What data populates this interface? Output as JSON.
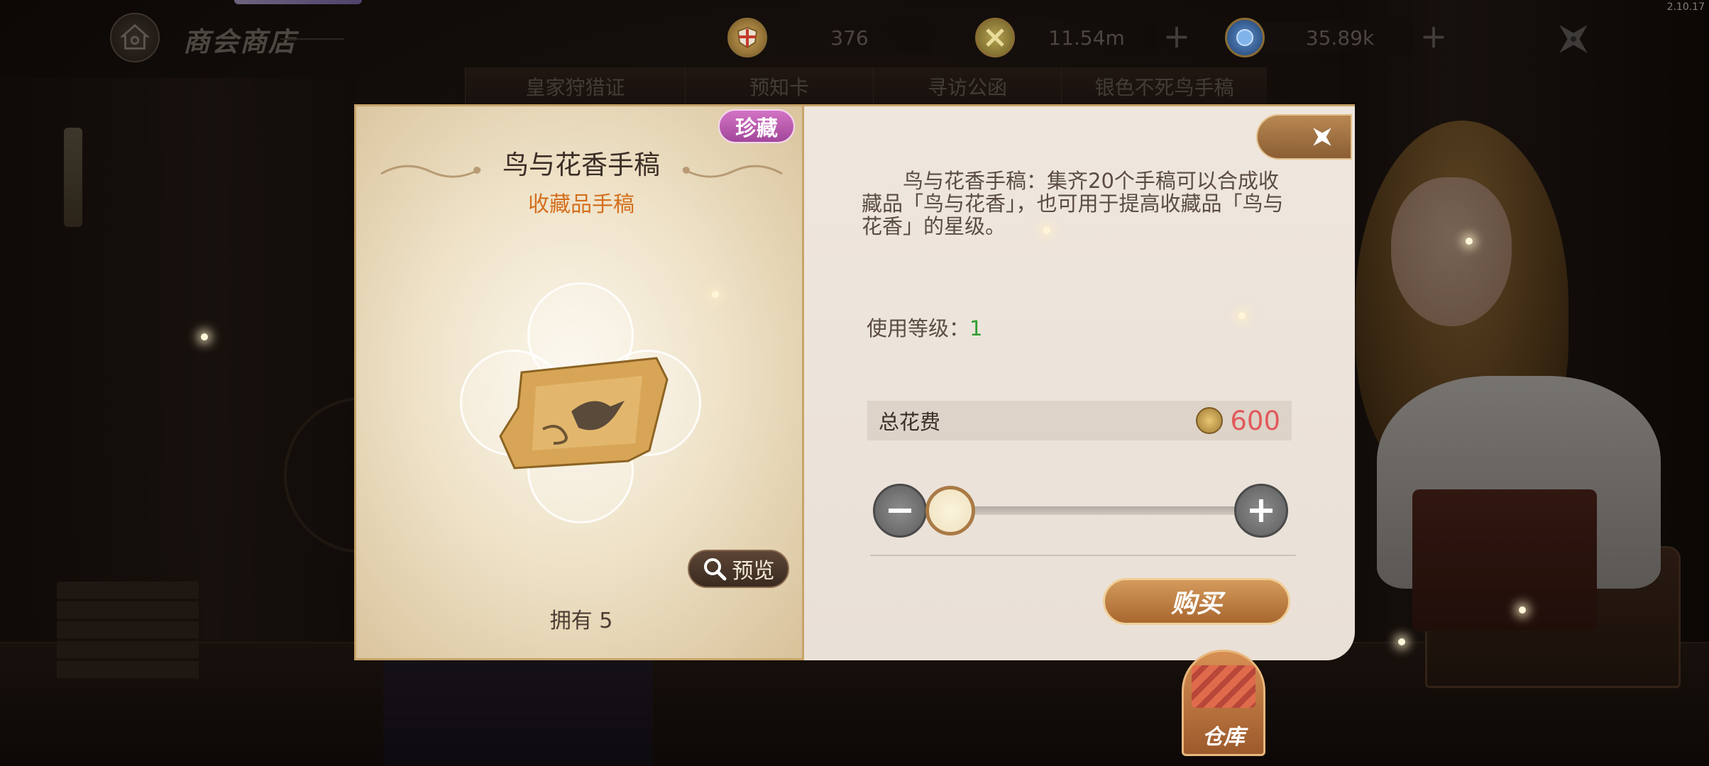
{
  "version": "2.10.17",
  "header": {
    "title": "商会商店",
    "currencies": [
      {
        "icon": "crest-coin-icon",
        "value": "376",
        "has_plus": false
      },
      {
        "icon": "gold-emblem-icon",
        "value": "11.54m",
        "has_plus": true
      },
      {
        "icon": "blue-gem-icon",
        "value": "35.89k",
        "has_plus": true
      }
    ]
  },
  "tabs": [
    "皇家狩猎证",
    "预知卡",
    "寻访公函",
    "银色不死鸟手稿"
  ],
  "item": {
    "rarity": "珍藏",
    "name": "鸟与花香手稿",
    "type": "收藏品手稿",
    "preview_label": "预览",
    "owned": "拥有 5",
    "description": "鸟与花香手稿：集齐20个手稿可以合成收藏品「鸟与花香」，也可用于提高收藏品「鸟与花香」的星级。",
    "level_label": "使用等级：",
    "level_value": "1",
    "cost_label": "总花费",
    "cost_value": "600",
    "quantity_fraction": 0,
    "buy_label": "购买"
  },
  "warehouse": {
    "label": "仓库"
  },
  "colors": {
    "rarity": "#c25bb5",
    "item_type": "#d46f1d",
    "level_value": "#2f9e2f",
    "cost_value": "#e15a5a",
    "buy_button": "#c0824a"
  }
}
